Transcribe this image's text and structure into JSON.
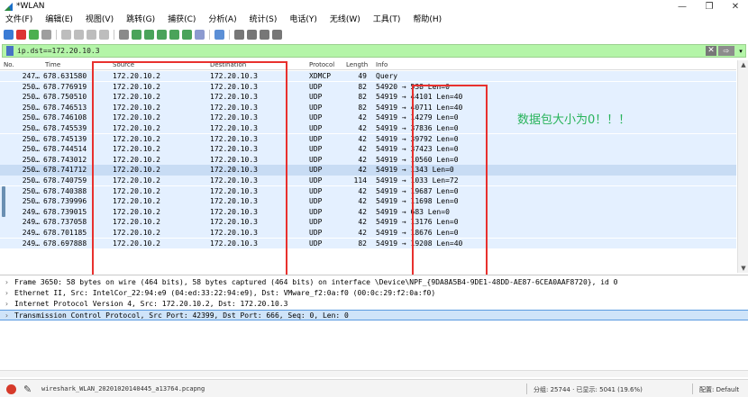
{
  "window": {
    "title": "*WLAN",
    "minimize": "—",
    "maximize": "❐",
    "close": "✕"
  },
  "menu": [
    "文件(F)",
    "编辑(E)",
    "视图(V)",
    "跳转(G)",
    "捕获(C)",
    "分析(A)",
    "统计(S)",
    "电话(Y)",
    "无线(W)",
    "工具(T)",
    "帮助(H)"
  ],
  "filter": {
    "value": "ip.dst==172.20.10.3",
    "clear": "✕",
    "apply": "⇨",
    "dropdown": "▾",
    "add": "+"
  },
  "columns": {
    "no": "No.",
    "time": "Time",
    "src": "Source",
    "dst": "Destination",
    "proto": "Protocol",
    "len": "Length",
    "info": "Info"
  },
  "packets": [
    {
      "no": "247…",
      "time": "678.631580",
      "src": "172.20.10.2",
      "dst": "172.20.10.3",
      "proto": "XDMCP",
      "len": "49",
      "info": "Query"
    },
    {
      "no": "250…",
      "time": "678.776919",
      "src": "172.20.10.2",
      "dst": "172.20.10.3",
      "proto": "UDP",
      "len": "82",
      "info": "54920 → 538 Len=0"
    },
    {
      "no": "250…",
      "time": "678.750510",
      "src": "172.20.10.2",
      "dst": "172.20.10.3",
      "proto": "UDP",
      "len": "82",
      "info": "54919 → 44101 Len=40"
    },
    {
      "no": "250…",
      "time": "678.746513",
      "src": "172.20.10.2",
      "dst": "172.20.10.3",
      "proto": "UDP",
      "len": "82",
      "info": "54919 → 40711 Len=40"
    },
    {
      "no": "250…",
      "time": "678.746108",
      "src": "172.20.10.2",
      "dst": "172.20.10.3",
      "proto": "UDP",
      "len": "42",
      "info": "54919 → 14279 Len=0"
    },
    {
      "no": "250…",
      "time": "678.745539",
      "src": "172.20.10.2",
      "dst": "172.20.10.3",
      "proto": "UDP",
      "len": "42",
      "info": "54919 → 37836 Len=0"
    },
    {
      "no": "250…",
      "time": "678.745139",
      "src": "172.20.10.2",
      "dst": "172.20.10.3",
      "proto": "UDP",
      "len": "42",
      "info": "54919 → 39792 Len=0"
    },
    {
      "no": "250…",
      "time": "678.744514",
      "src": "172.20.10.2",
      "dst": "172.20.10.3",
      "proto": "UDP",
      "len": "42",
      "info": "54919 → 37423 Len=0"
    },
    {
      "no": "250…",
      "time": "678.743012",
      "src": "172.20.10.2",
      "dst": "172.20.10.3",
      "proto": "UDP",
      "len": "42",
      "info": "54919 → 10560 Len=0"
    },
    {
      "no": "250…",
      "time": "678.741712",
      "src": "172.20.10.2",
      "dst": "172.20.10.3",
      "proto": "UDP",
      "len": "42",
      "info": "54919 → 1343 Len=0",
      "selected": true
    },
    {
      "no": "250…",
      "time": "678.740759",
      "src": "172.20.10.2",
      "dst": "172.20.10.3",
      "proto": "UDP",
      "len": "114",
      "info": "54919 → 1033 Len=72"
    },
    {
      "no": "250…",
      "time": "678.740388",
      "src": "172.20.10.2",
      "dst": "172.20.10.3",
      "proto": "UDP",
      "len": "42",
      "info": "54919 → 19687 Len=0"
    },
    {
      "no": "250…",
      "time": "678.739996",
      "src": "172.20.10.2",
      "dst": "172.20.10.3",
      "proto": "UDP",
      "len": "42",
      "info": "54919 → 11698 Len=0"
    },
    {
      "no": "249…",
      "time": "678.739015",
      "src": "172.20.10.2",
      "dst": "172.20.10.3",
      "proto": "UDP",
      "len": "42",
      "info": "54919 → 683 Len=0"
    },
    {
      "no": "249…",
      "time": "678.737058",
      "src": "172.20.10.2",
      "dst": "172.20.10.3",
      "proto": "UDP",
      "len": "42",
      "info": "54919 → 13176 Len=0"
    },
    {
      "no": "249…",
      "time": "678.701185",
      "src": "172.20.10.2",
      "dst": "172.20.10.3",
      "proto": "UDP",
      "len": "42",
      "info": "54919 → 18676 Len=0"
    },
    {
      "no": "249…",
      "time": "678.697888",
      "src": "172.20.10.2",
      "dst": "172.20.10.3",
      "proto": "UDP",
      "len": "82",
      "info": "54919 → 19208 Len=40"
    }
  ],
  "annotation": "数据包大小为0！！！",
  "details": [
    {
      "text": "Frame 3650: 58 bytes on wire (464 bits), 58 bytes captured (464 bits) on interface \\Device\\NPF_{9DA8A5B4-9DE1-48DD-AE87-6CEA0AAF8720}, id 0"
    },
    {
      "text": "Ethernet II, Src: IntelCor_22:94:e9 (04:ed:33:22:94:e9), Dst: VMware_f2:0a:f0 (00:0c:29:f2:0a:f0)"
    },
    {
      "text": "Internet Protocol Version 4, Src: 172.20.10.2, Dst: 172.20.10.3"
    },
    {
      "text": "Transmission Control Protocol, Src Port: 42399, Dst Port: 666, Seq: 0, Len: 0",
      "selected": true
    }
  ],
  "status": {
    "file": "wireshark_WLAN_20201020140445_a13764.pcapng",
    "stats": "分组: 25744 · 已显示: 5041 (19.6%)",
    "profile": "配置: Default"
  },
  "colors": {
    "accent": "#e8312e",
    "filter_bg": "#b4f5a8",
    "row_bg": "#e4f0ff",
    "annotation": "#27b35a"
  },
  "toolbar_icons": [
    "shark-fin-start-icon",
    "stop-icon",
    "restart-icon",
    "options-icon",
    "open-icon",
    "save-icon",
    "close-file-icon",
    "reload-icon",
    "find-icon",
    "back-icon",
    "forward-icon",
    "goto-icon",
    "first-icon",
    "last-icon",
    "autoscroll-icon",
    "colorize-icon",
    "zoom-in-icon",
    "zoom-out-icon",
    "zoom-reset-icon",
    "resize-columns-icon"
  ]
}
